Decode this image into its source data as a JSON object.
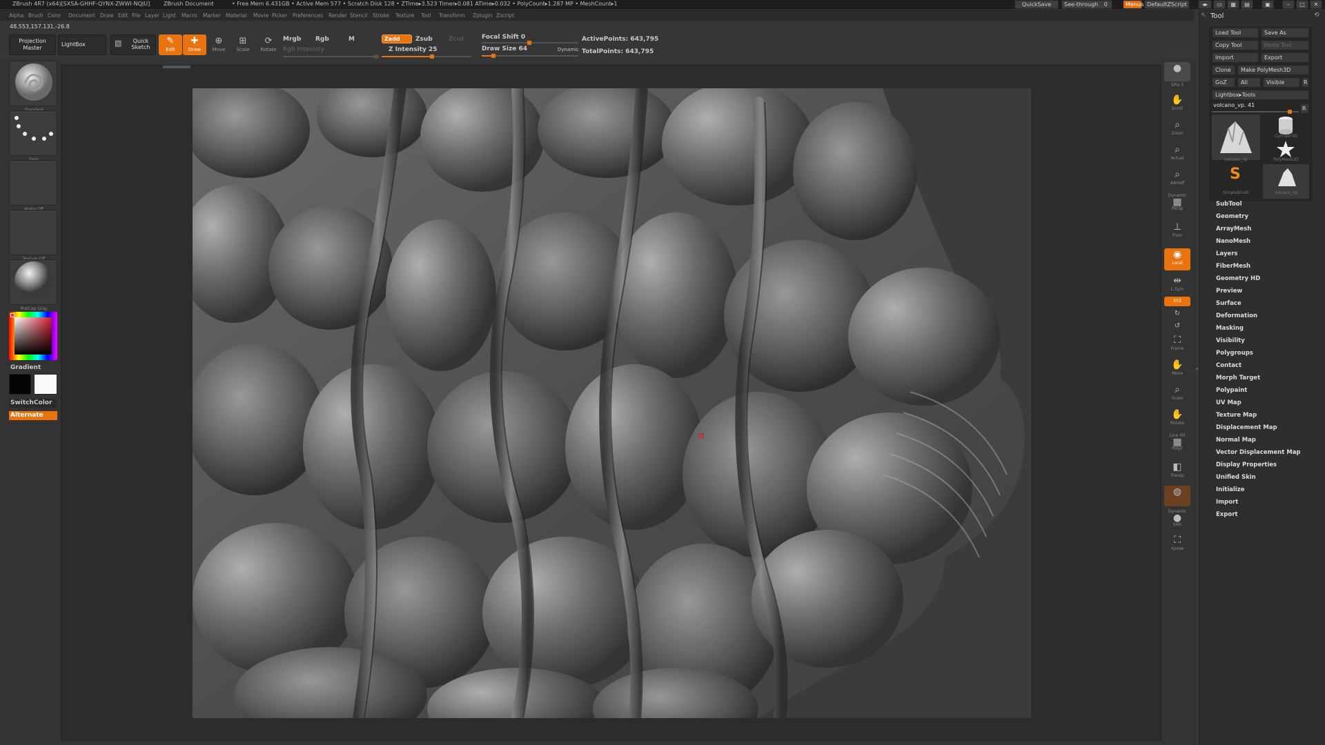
{
  "titlebar": {
    "app_title": "ZBrush 4R7 (x64)[SXSA-GHHF-QYNX-ZWWI-NQJU]",
    "doc_title": "ZBrush Document",
    "stats": "• Free Mem 6.431GB • Active Mem 577 • Scratch Disk 128 • ZTime▸3.523 Timer▸0.081 ATime▸0.032 • PolyCount▸1.287 MP • MeshCount▸1",
    "quicksave": "QuickSave",
    "see_through": "See-through",
    "see_through_value": "0",
    "menus": "Menus",
    "default_zscript": "DefaultZScript"
  },
  "menubar": [
    "Alpha",
    "Brush",
    "Color",
    "Document",
    "Draw",
    "Edit",
    "File",
    "Layer",
    "Light",
    "Macro",
    "Marker",
    "Material",
    "Movie",
    "Picker",
    "Preferences",
    "Render",
    "Stencil",
    "Stroke",
    "Texture",
    "Tool",
    "Transform",
    "Zplugin",
    "Zscript"
  ],
  "coords": "48.553,157.131,-26.8",
  "toolbar": {
    "projection_master": "Projection Master",
    "lightbox": "LightBox",
    "quick_sketch": "Quick Sketch",
    "edit": "Edit",
    "draw": "Draw",
    "move": "Move",
    "scale": "Scale",
    "rotate": "Rotate",
    "mrgb": "Mrgb",
    "rgb": "Rgb",
    "m": "M",
    "rgb_intensity": "Rgb Intensity",
    "zadd": "Zadd",
    "zsub": "Zsub",
    "zcut": "Zcut",
    "z_intensity": "Z Intensity 25",
    "z_intensity_value": 25,
    "focal_shift": "Focal Shift 0",
    "draw_size": "Draw Size 64",
    "dynamic": "Dynamic",
    "active_points": "ActivePoints: 643,795",
    "total_points": "TotalPoints: 643,795"
  },
  "leftshelf": {
    "brush": "Standard",
    "stroke": "Dots",
    "alpha": "Alpha Off",
    "texture": "Texture Off",
    "material": "MatCap Gray",
    "gradient": "Gradient",
    "switchcolor": "SwitchColor",
    "alternate": "Alternate"
  },
  "rightshelf": [
    {
      "name": "bpr",
      "label": ""
    },
    {
      "name": "spix",
      "label": "SPix 3"
    },
    {
      "name": "scroll",
      "label": "Scroll"
    },
    {
      "name": "zoom",
      "label": "Zoom"
    },
    {
      "name": "actual",
      "label": "Actual"
    },
    {
      "name": "aahalf",
      "label": "AAHalf"
    },
    {
      "name": "persp",
      "label": "Persp"
    },
    {
      "name": "floor",
      "label": "Floor"
    },
    {
      "name": "local",
      "label": "Local"
    },
    {
      "name": "lsym",
      "label": "L.Sym"
    },
    {
      "name": "xyz",
      "label": "XYZ"
    },
    {
      "name": "frame",
      "label": "Frame"
    },
    {
      "name": "move",
      "label": "Move"
    },
    {
      "name": "scale",
      "label": "Scale"
    },
    {
      "name": "rotate",
      "label": "Rotate"
    },
    {
      "name": "polyf",
      "label": "PolyF"
    },
    {
      "name": "transp",
      "label": "Transp"
    },
    {
      "name": "ghost",
      "label": "Dynamic"
    },
    {
      "name": "solo",
      "label": "Solo"
    },
    {
      "name": "xpose",
      "label": "Xpose"
    }
  ],
  "rightshelf_extra": {
    "dynamic_label": "Dynamic",
    "linefill_label": "Line Fill"
  },
  "toolpanel": {
    "title": "Tool",
    "load_tool": "Load Tool",
    "save_as": "Save As",
    "copy_tool": "Copy Tool",
    "paste_tool": "Paste Tool",
    "import": "Import",
    "export": "Export",
    "clone": "Clone",
    "make_polymesh": "Make PolyMesh3D",
    "goz": "GoZ",
    "all": "All",
    "visible": "Visible",
    "r": "R",
    "lightbox_tools": "Lightbox▸Tools",
    "current_tool": "volcano_vp. 41",
    "thumbs": [
      "volcano_vp",
      "Cylinder3D",
      "PolyMesh3D",
      "SimpleBrush",
      "volcano_vp"
    ],
    "sections": [
      "SubTool",
      "Geometry",
      "ArrayMesh",
      "NanoMesh",
      "Layers",
      "FiberMesh",
      "Geometry HD",
      "Preview",
      "Surface",
      "Deformation",
      "Masking",
      "Visibility",
      "Polygroups",
      "Contact",
      "Morph Target",
      "Polypaint",
      "UV Map",
      "Texture Map",
      "Displacement Map",
      "Normal Map",
      "Vector Displacement Map",
      "Display Properties",
      "Unified Skin",
      "Initialize",
      "Import",
      "Export"
    ]
  }
}
